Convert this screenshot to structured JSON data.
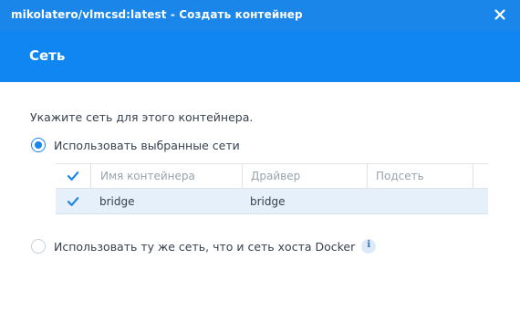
{
  "window": {
    "title": "mikolatero/vlmcsd:latest - Создать контейнер",
    "close_icon": "close-icon"
  },
  "header": {
    "title": "Сеть"
  },
  "content": {
    "instruction": "Укажите сеть для этого контейнера.",
    "options": [
      {
        "label": "Использовать выбранные сети",
        "checked": true
      },
      {
        "label": "Использовать ту же сеть, что и сеть хоста Docker",
        "checked": false,
        "info_icon": "info-icon"
      }
    ],
    "table": {
      "columns": [
        "Имя контейнера",
        "Драйвер",
        "Подсеть"
      ],
      "header_checked": true,
      "rows": [
        {
          "checked": true,
          "name": "bridge",
          "driver": "bridge",
          "subnet": ""
        }
      ]
    }
  },
  "colors": {
    "titlebar": "#1a86ea",
    "header": "#0f86f2",
    "selected_row": "#e5f0fb",
    "accent": "#1a86ea"
  }
}
